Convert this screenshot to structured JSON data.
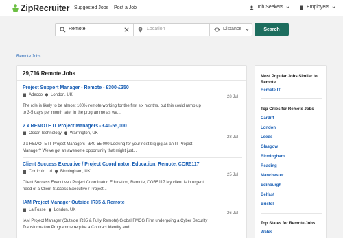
{
  "header": {
    "logo_text": "ZipRecruiter",
    "nav": [
      "Suggested Jobs",
      "Post a Job"
    ],
    "job_seekers": "Job Seekers",
    "employers": "Employers"
  },
  "search": {
    "query_value": "Remote",
    "location_placeholder": "Location",
    "distance_label": "Distance",
    "button_label": "Search"
  },
  "breadcrumb": "Remote Jobs",
  "results": {
    "title": "29,716 Remote Jobs",
    "jobs": [
      {
        "title": "Project Support Manager - Remote - £300-£350",
        "company": "Adecco",
        "location": "London, UK",
        "date": "28 Jul",
        "snippet_1": "The role is likely to be almost 100% remote working for the first six months, but this could ramp up",
        "snippet_2": "to 3-5 days per month later in the programme as we..."
      },
      {
        "title": "2 x REMOTE IT Project Managers - £40-55,000",
        "company": "Oscar Technology",
        "location": "Warrington, UK",
        "date": "28 Jul",
        "snippet_1": "2 x REMOTE IT Project Managers - £40-55,000 Looking for your next big gig as an IT Project",
        "snippet_2": "Manager? We've got an awesome opportunity that might just..."
      },
      {
        "title": "Client Success Executive / Project Coordinator, Education, Remote, COR5117",
        "company": "Corriculo Ltd",
        "location": "Birmingham, UK",
        "date": "25 Jul",
        "snippet_1": "Client Success Executive / Project Coordinator, Education, Remote, COR5117 My client is in urgent",
        "snippet_2": "need of a Client Success Executive / Project..."
      },
      {
        "title": "IAM Project Manager Outside IR35 & Remote",
        "company": "La Fosse",
        "location": "London, UK",
        "date": "26 Jul",
        "snippet_1": "IAM Project Manager (Outside IR35 & Fully Remote) Global FMCG Firm undergoing a Cyber Security",
        "snippet_2": "Transformation Programme require a Contract Identity and..."
      }
    ]
  },
  "sidebar": {
    "popular_heading": "Most Popular Jobs Similar to Remote",
    "popular_links": [
      "Remote IT"
    ],
    "cities_heading": "Top Cities for Remote Jobs",
    "cities": [
      "Cardiff",
      "London",
      "Leeds",
      "Glasgow",
      "Birmingham",
      "Reading",
      "Manchester",
      "Edinburgh",
      "Belfast",
      "Bristol"
    ],
    "states_heading": "Top States for Remote Jobs",
    "states": [
      "Wales"
    ]
  },
  "colors": {
    "accent": "#1d6d5e",
    "link": "#1a5fb4",
    "logo_green": "#6cbf43"
  }
}
